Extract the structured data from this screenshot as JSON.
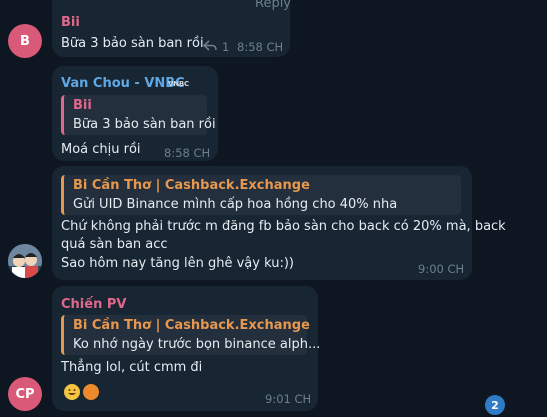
{
  "top_reply_label": "Reply",
  "messages": [
    {
      "avatar_initial": "B",
      "avatar_color": "#d85a78",
      "sender": "Bii",
      "sender_color": "#e0688a",
      "text": "Bữa 3 bảo sàn ban rồi",
      "reply_count": "1",
      "time": "8:58 CH"
    },
    {
      "sender": "Van Chou - VNBC",
      "sender_color": "#5fa8e6",
      "badge": "VNBC",
      "quote": {
        "name": "Bii",
        "name_color": "#e0688a",
        "text": "Bữa 3 bảo sàn ban rồi"
      },
      "text": "Moá chịu rồi",
      "time": "8:58 CH"
    },
    {
      "avatar_icon": "cartoon-avatar",
      "quote": {
        "name": "Bi Cần Thơ | Cashback.Exchange",
        "name_color": "#e7984e",
        "text": "Gửi UID Binance mình cấp hoa hồng cho 40% nha"
      },
      "lines": [
        "Chứ không phải trước m đăng fb bảo sàn cho back có 20% mà, back",
        "quá sàn ban acc",
        "Sao hôm nay tăng lên ghê vậy ku:))"
      ],
      "time": "9:00 CH"
    },
    {
      "avatar_initial": "CP",
      "avatar_color": "#d85a78",
      "sender": "Chiến PV",
      "sender_color": "#e0688a",
      "quote": {
        "name": "Bi Cần Thơ | Cashback.Exchange",
        "name_color": "#e7984e",
        "text": "Ko nhớ ngày trước bọn binance alph..."
      },
      "text": "Thẳng lol, cút cmm đi",
      "emojis": [
        "grinning-emoji",
        "orange-circle-emoji"
      ],
      "time": "9:01 CH"
    }
  ],
  "unread_count": "2"
}
